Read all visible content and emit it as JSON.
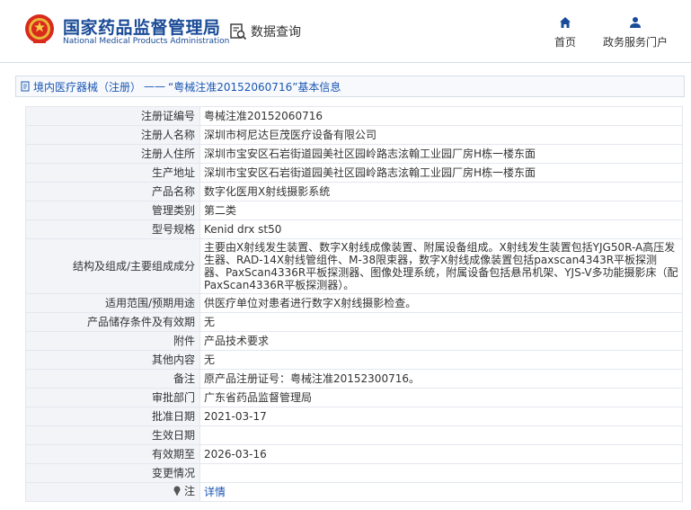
{
  "header": {
    "brand_cn": "国家药品监督管理局",
    "brand_en": "National Medical Products Administration",
    "data_query": "数据查询",
    "nav_home": "首页",
    "nav_service": "政务服务门户"
  },
  "breadcrumb": {
    "section": "境内医疗器械（注册）",
    "separator": "——",
    "title": "“粤械注准20152060716”基本信息"
  },
  "rows": [
    {
      "key": "注册证编号",
      "value": "粤械注准20152060716"
    },
    {
      "key": "注册人名称",
      "value": "深圳市柯尼达巨茂医疗设备有限公司"
    },
    {
      "key": "注册人住所",
      "value": "深圳市宝安区石岩街道园美社区园岭路志泫翰工业园厂房H栋一楼东面"
    },
    {
      "key": "生产地址",
      "value": "深圳市宝安区石岩街道园美社区园岭路志泫翰工业园厂房H栋一楼东面"
    },
    {
      "key": "产品名称",
      "value": "数字化医用X射线摄影系统"
    },
    {
      "key": "管理类别",
      "value": "第二类"
    },
    {
      "key": "型号规格",
      "value": "Kenid drx st50"
    },
    {
      "key": "结构及组成/主要组成成分",
      "value": "主要由X射线发生装置、数字X射线成像装置、附属设备组成。X射线发生装置包括YJG50R-A高压发生器、RAD-14X射线管组件、M-38限束器，数字X射线成像装置包括paxscan4343R平板探测器、PaxScan4336R平板探测器、图像处理系统，附属设备包括悬吊机架、YJS-V多功能摄影床（配PaxScan4336R平板探测器）。"
    },
    {
      "key": "适用范围/预期用途",
      "value": "供医疗单位对患者进行数字X射线摄影检查。"
    },
    {
      "key": "产品储存条件及有效期",
      "value": "无"
    },
    {
      "key": "附件",
      "value": "产品技术要求"
    },
    {
      "key": "其他内容",
      "value": "无"
    },
    {
      "key": "备注",
      "value": "原产品注册证号：粤械注准20152300716。"
    },
    {
      "key": "审批部门",
      "value": "广东省药品监督管理局"
    },
    {
      "key": "批准日期",
      "value": "2021-03-17"
    },
    {
      "key": "生效日期",
      "value": ""
    },
    {
      "key": "有效期至",
      "value": "2026-03-16"
    },
    {
      "key": "变更情况",
      "value": ""
    }
  ],
  "note": {
    "key": "注",
    "link": "详情"
  },
  "colors": {
    "brand_blue": "#1a4b97",
    "link_blue": "#1a56b3",
    "key_bg": "#f2f4f8"
  }
}
